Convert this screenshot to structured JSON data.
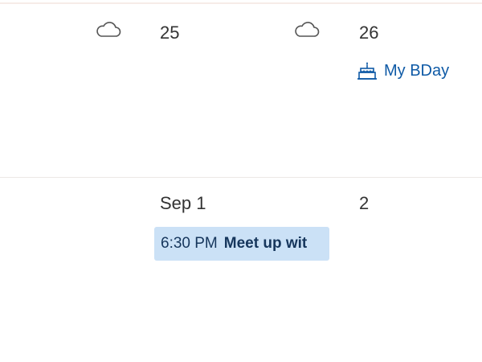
{
  "week1": {
    "day25": {
      "label": "25",
      "weather_icon": "cloud-icon"
    },
    "day26": {
      "label": "26",
      "weather_icon": "cloud-icon"
    },
    "event_bday": {
      "icon": "birthday-cake-icon",
      "title": "My BDay"
    }
  },
  "week2": {
    "day_sep1": {
      "label": "Sep 1"
    },
    "day2": {
      "label": "2"
    },
    "event_meetup": {
      "time": "6:30 PM",
      "title": "Meet up wit"
    }
  },
  "colors": {
    "event_text": "#0f5aa6",
    "event_bg": "#cbe1f6",
    "day_text": "#333333"
  }
}
